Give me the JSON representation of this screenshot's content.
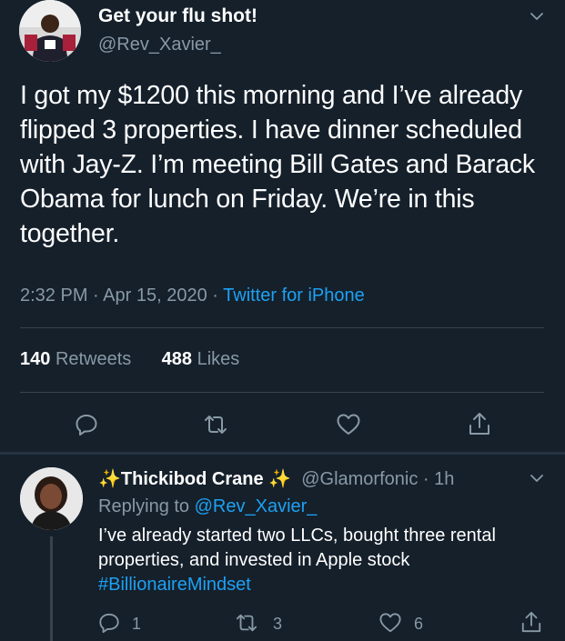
{
  "main_tweet": {
    "display_name": "Get your flu shot!",
    "handle": "@Rev_Xavier_",
    "text": "I got my $1200 this morning and I’ve already flipped 3 properties. I have dinner scheduled with Jay-Z. I’m meeting Bill Gates and Barack Obama for lunch on Friday. We’re in this together.",
    "time": "2:32 PM",
    "date": "Apr 15, 2020",
    "separator": "·",
    "source": "Twitter for iPhone",
    "retweets_count": "140",
    "retweets_label": "Retweets",
    "likes_count": "488",
    "likes_label": "Likes"
  },
  "reply_tweet": {
    "sparkle_left": "✨",
    "display_name": "Thickibod Crane",
    "sparkle_right": "✨",
    "handle": "@Glamorfonic",
    "separator": "·",
    "time_ago": "1h",
    "replying_prefix": "Replying to",
    "replying_to": "@Rev_Xavier_",
    "text": "I’ve already started two LLCs, bought three rental properties, and invested in Apple stock",
    "hashtag": "#BillionaireMindset",
    "reply_count": "1",
    "retweet_count": "3",
    "like_count": "6"
  },
  "colors": {
    "background": "#15202b",
    "text_primary": "#ffffff",
    "text_secondary": "#8899a6",
    "link": "#1da1f2",
    "divider": "#38444d"
  },
  "icons": {
    "chevron": "chevron-down-icon",
    "reply": "reply-icon",
    "retweet": "retweet-icon",
    "like": "heart-icon",
    "share": "share-icon"
  }
}
